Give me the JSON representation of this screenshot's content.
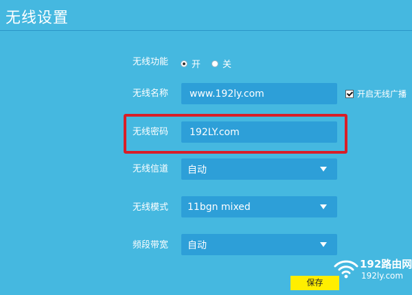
{
  "page": {
    "title": "无线设置"
  },
  "wireless_function": {
    "label": "无线功能",
    "options": [
      "开",
      "关"
    ],
    "selected": "开"
  },
  "wireless_name": {
    "label": "无线名称",
    "value": "www.192ly.com"
  },
  "broadcast": {
    "label": "开启无线广播",
    "checked": true
  },
  "wireless_password": {
    "label": "无线密码",
    "value": "192LY.com"
  },
  "channel": {
    "label": "无线信道",
    "value": "自动"
  },
  "mode": {
    "label": "无线模式",
    "value": "11bgn mixed"
  },
  "bandwidth": {
    "label": "频段带宽",
    "value": "自动"
  },
  "save_label": "保存",
  "watermark": {
    "main": "192路由网",
    "sub": "192ly.com",
    "overlay": "192"
  },
  "colors": {
    "background": "#45b8e0",
    "field": "#2d9fd8",
    "highlight": "#d81e28",
    "save": "#ffee00"
  }
}
